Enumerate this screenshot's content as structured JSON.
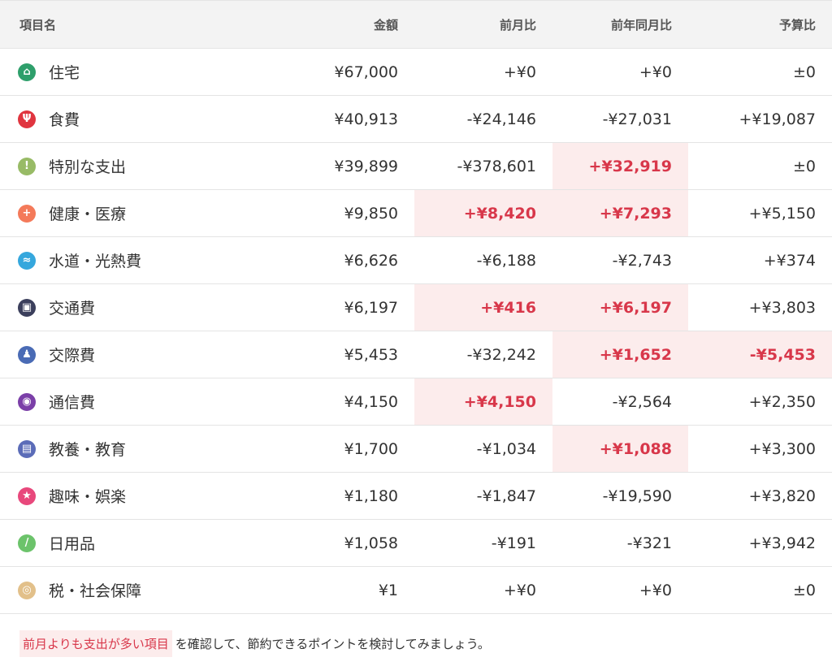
{
  "header": {
    "col_name": "項目名",
    "col_amount": "金額",
    "col_mom": "前月比",
    "col_yoy": "前年同月比",
    "col_budget": "予算比"
  },
  "rows": [
    {
      "name": "住宅",
      "amount": "¥67,000",
      "mom": "+¥0",
      "yoy": "+¥0",
      "budget": "±0",
      "icon": "house-icon",
      "color": "#2e9f6b",
      "glyph": "⌂"
    },
    {
      "name": "食費",
      "amount": "¥40,913",
      "mom": "-¥24,146",
      "yoy": "-¥27,031",
      "budget": "+¥19,087",
      "icon": "fork-knife-icon",
      "color": "#e0353f",
      "glyph": "Ψ"
    },
    {
      "name": "特別な支出",
      "amount": "¥39,899",
      "mom": "-¥378,601",
      "yoy": "+¥32,919",
      "budget": "±0",
      "icon": "exclamation-icon",
      "color": "#98bb66",
      "glyph": "!"
    },
    {
      "name": "健康・医療",
      "amount": "¥9,850",
      "mom": "+¥8,420",
      "yoy": "+¥7,293",
      "budget": "+¥5,150",
      "icon": "medical-cross-icon",
      "color": "#f47a5a",
      "glyph": "+"
    },
    {
      "name": "水道・光熱費",
      "amount": "¥6,626",
      "mom": "-¥6,188",
      "yoy": "-¥2,743",
      "budget": "+¥374",
      "icon": "faucet-icon",
      "color": "#35a7dd",
      "glyph": "≈"
    },
    {
      "name": "交通費",
      "amount": "¥6,197",
      "mom": "+¥416",
      "yoy": "+¥6,197",
      "budget": "+¥3,803",
      "icon": "train-icon",
      "color": "#3b3f5c",
      "glyph": "▣"
    },
    {
      "name": "交際費",
      "amount": "¥5,453",
      "mom": "-¥32,242",
      "yoy": "+¥1,652",
      "budget": "-¥5,453",
      "icon": "people-icon",
      "color": "#4a6bb5",
      "glyph": "♟"
    },
    {
      "name": "通信費",
      "amount": "¥4,150",
      "mom": "+¥4,150",
      "yoy": "-¥2,564",
      "budget": "+¥2,350",
      "icon": "antenna-icon",
      "color": "#7b3fa8",
      "glyph": "◉"
    },
    {
      "name": "教養・教育",
      "amount": "¥1,700",
      "mom": "-¥1,034",
      "yoy": "+¥1,088",
      "budget": "+¥3,300",
      "icon": "book-icon",
      "color": "#5b6cb8",
      "glyph": "▤"
    },
    {
      "name": "趣味・娯楽",
      "amount": "¥1,180",
      "mom": "-¥1,847",
      "yoy": "-¥19,590",
      "budget": "+¥3,820",
      "icon": "star-icon",
      "color": "#e8487c",
      "glyph": "★"
    },
    {
      "name": "日用品",
      "amount": "¥1,058",
      "mom": "-¥191",
      "yoy": "-¥321",
      "budget": "+¥3,942",
      "icon": "brush-icon",
      "color": "#6cc36b",
      "glyph": "/"
    },
    {
      "name": "税・社会保障",
      "amount": "¥1",
      "mom": "+¥0",
      "yoy": "+¥0",
      "budget": "±0",
      "icon": "tax-coin-icon",
      "color": "#e2c08a",
      "glyph": "◎"
    }
  ],
  "highlights": [
    {
      "row": 2,
      "col": "yoy"
    },
    {
      "row": 3,
      "col": "mom"
    },
    {
      "row": 3,
      "col": "yoy"
    },
    {
      "row": 5,
      "col": "mom"
    },
    {
      "row": 5,
      "col": "yoy"
    },
    {
      "row": 6,
      "col": "yoy"
    },
    {
      "row": 6,
      "col": "budget"
    },
    {
      "row": 7,
      "col": "mom"
    },
    {
      "row": 8,
      "col": "yoy"
    }
  ],
  "footer": {
    "marked": "前月よりも支出が多い項目",
    "rest": "を確認して、節約できるポイントを検討してみましょう。"
  },
  "colors": {
    "highlight_bg": "#fcecec",
    "highlight_text": "#d8374a",
    "header_bg": "#f3f3f3"
  }
}
